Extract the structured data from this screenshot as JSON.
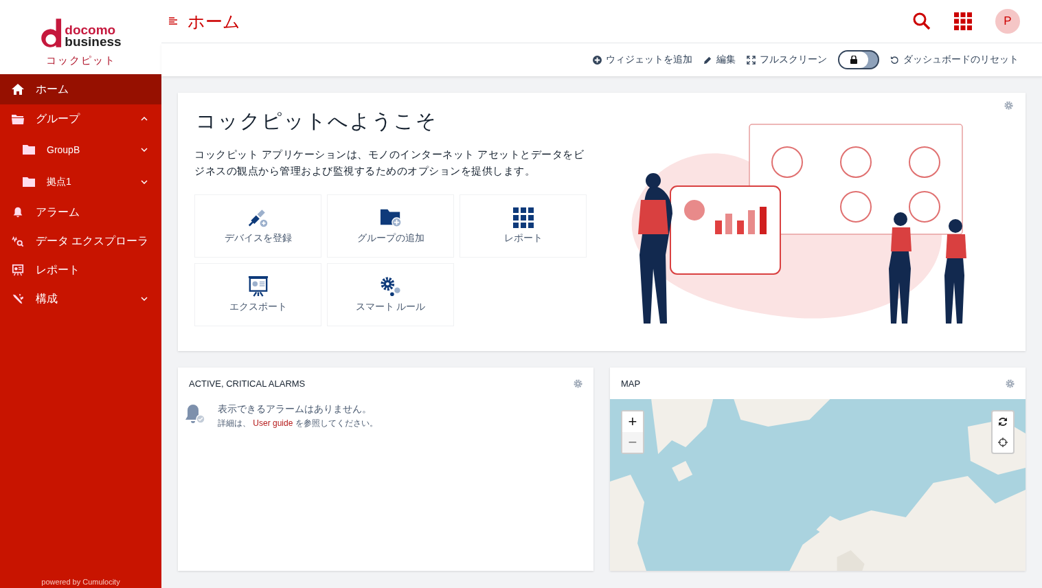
{
  "logo": {
    "line1": "docomo",
    "line2": "business",
    "app_name": "コックピット"
  },
  "sidebar": {
    "items": [
      {
        "label": "ホーム",
        "selected": true
      },
      {
        "label": "グループ",
        "selected": false,
        "expanded": true,
        "children": [
          {
            "label": "GroupB",
            "selected": false,
            "expanded": false
          },
          {
            "label": "拠点1",
            "selected": false,
            "expanded": false
          }
        ]
      },
      {
        "label": "アラーム",
        "selected": false
      },
      {
        "label": "データ エクスプローラ",
        "selected": false
      },
      {
        "label": "レポート",
        "selected": false
      },
      {
        "label": "構成",
        "selected": false,
        "expanded": false
      }
    ],
    "footer": "powered by Cumulocity"
  },
  "header": {
    "title": "ホーム",
    "avatar": "P"
  },
  "toolbar": {
    "add_widget": "ウィジェットを追加",
    "edit": "編集",
    "fullscreen": "フルスクリーン",
    "locked": true,
    "reset": "ダッシュボードのリセット"
  },
  "welcome": {
    "title": "コックピットへようこそ",
    "description": "コックピット アプリケーションは、モノのインターネット アセットとデータをビジネスの観点から管理および監視するためのオプションを提供します。",
    "tiles": [
      {
        "label": "デバイスを登録"
      },
      {
        "label": "グループの追加"
      },
      {
        "label": "レポート"
      },
      {
        "label": "エクスポート"
      },
      {
        "label": "スマート ルール"
      }
    ]
  },
  "alarms": {
    "title": "ACTIVE, CRITICAL ALARMS",
    "message": "表示できるアラームはありません。",
    "detail_before": "詳細は、",
    "link": "User guide",
    "detail_after": "を参照してください。"
  },
  "map": {
    "title": "MAP",
    "zoom": [
      {
        "label": "+",
        "disabled": false
      },
      {
        "label": "−",
        "disabled": true
      }
    ]
  }
}
